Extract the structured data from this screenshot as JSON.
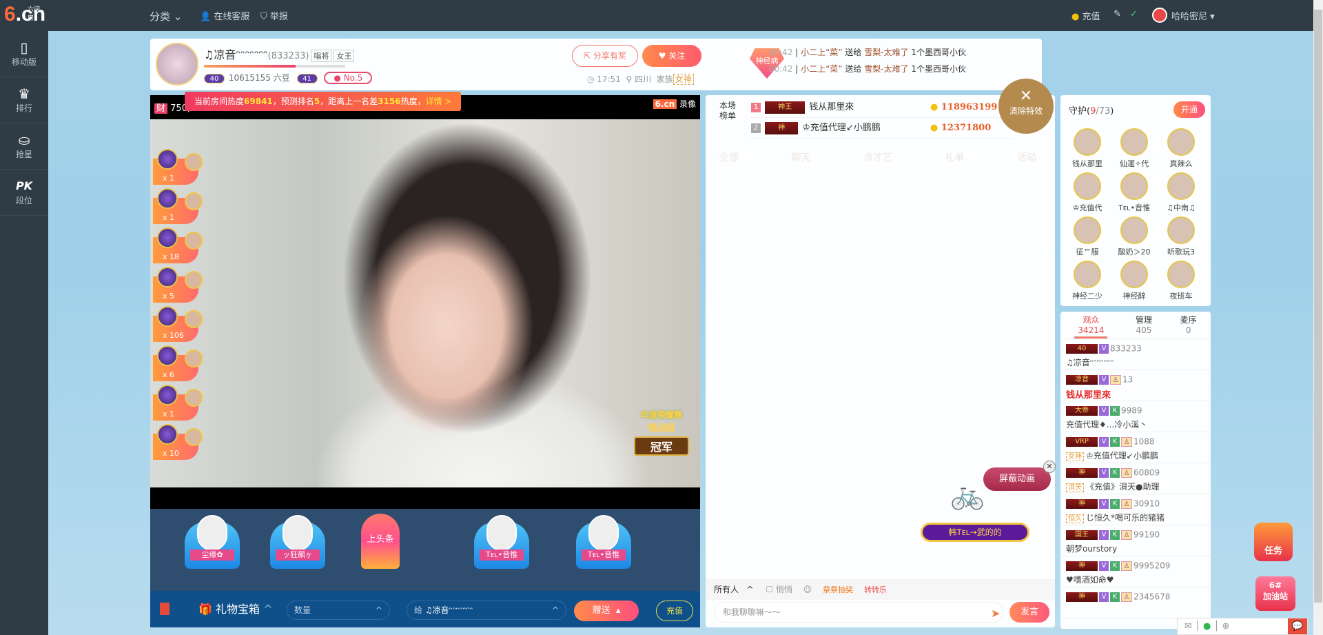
{
  "topbar": {
    "logo_sub": "六间房",
    "logo_main": "6.cn",
    "category": "分类",
    "service": "在线客服",
    "report": "举报",
    "recharge": "充值",
    "username": "哈哈密尼"
  },
  "sidebar": [
    {
      "label": "移动版",
      "icon": "phone-icon"
    },
    {
      "label": "排行",
      "icon": "crown-icon"
    },
    {
      "label": "抢星",
      "icon": "star-bag-icon"
    },
    {
      "label": "段位",
      "icon": "pk-icon",
      "glyph": "PK"
    }
  ],
  "anchor": {
    "name": "♫凉音ᵔᵔᵔᵔᵔᵔᵔ",
    "id": "(833233)",
    "tags": [
      "唱将",
      "女王"
    ],
    "level_left": "40",
    "beans": "10615155 六豆",
    "level_right": "41",
    "rank": "No.5",
    "time": "17:51",
    "location": "四川",
    "family_label": "家族",
    "family": "女神",
    "share": "分享有奖",
    "follow": "关注",
    "badge": "神经病",
    "progress_pct": 65
  },
  "heat_tip": {
    "p1": "当前房间热度",
    "heat": "69841",
    "p2": "，预测排名",
    "rank": "5",
    "p3": "，距离上一名差",
    "diff": "3156",
    "p4": "热度，",
    "link": "详情 >"
  },
  "feed": [
    {
      "time": "00:42",
      "from": "小二上“菜”",
      "action": "送给",
      "to": "雪梨-太难了",
      "gift": "1个墨西哥小伙"
    },
    {
      "time": "00:42",
      "from": "小二上“菜”",
      "action": "送给",
      "to": "雪梨-太难了",
      "gift": "1个墨西哥小伙"
    }
  ],
  "video": {
    "wealth_badge": "财",
    "wealth": "750,",
    "watermark": "6.cn",
    "record": "录像",
    "honor_title": "年度荣耀赛",
    "honor_group": "唱战组",
    "honor_rank": "冠军"
  },
  "gift_list": [
    "x 1",
    "x 1",
    "x 18",
    "x 5",
    "x 106",
    "x 6",
    "x 1",
    "x 10"
  ],
  "seats": [
    "尘缘✿",
    "ッ狂飙ヶ",
    "上头条",
    "Tᴇʟ•音惟",
    "Tᴇʟ•音惟"
  ],
  "bottom": {
    "gift_box": "礼物宝箱",
    "quantity_placeholder": "数量",
    "to_label": "给",
    "to_name": "♫凉音ᵔᵔᵔᵔᵔᵔᵔ",
    "send": "赠送",
    "recharge": "充值"
  },
  "ranking": {
    "label": "本场榜单",
    "rows": [
      {
        "rank": "1",
        "badge": "神王",
        "name": "钱从那里來",
        "score": "118963199"
      },
      {
        "rank": "2",
        "badge": "神",
        "name": "♔充值代理↙小鹏鹏",
        "score": "12371800"
      }
    ]
  },
  "clear_effects": "清除特效",
  "chat": {
    "tabs": [
      "全部",
      "聊天",
      "点才艺",
      "礼单",
      "活动"
    ],
    "block_anim": "屏蔽动画",
    "rider": "韩Tᴇʟ→武的的",
    "target": "所有人",
    "whisper": "悄悄",
    "lottery": "祭祭抽奖",
    "wheel": "转转乐",
    "placeholder": "和我聊聊嘛～～",
    "send": "发言"
  },
  "guard": {
    "title": "守护",
    "count": "9",
    "total": "/73",
    "open": "开通",
    "members": [
      "钱从那里",
      "仙運✧代",
      "真辣么",
      "♔充值代",
      "Tᴇʟ•音惟",
      "♫中南♫",
      "征™服",
      "酸奶＞20",
      "听歌玩3",
      "神经二少",
      "神经醉",
      "夜班车"
    ]
  },
  "audience": {
    "tabs": [
      {
        "label": "观众",
        "count": "34214"
      },
      {
        "label": "管理",
        "count": "405"
      },
      {
        "label": "麦序",
        "count": "0"
      }
    ],
    "rows": [
      {
        "badge": "40",
        "num": "833233",
        "name": "♫凉音ᵔᵔᵔᵔᵔᵔᵔ"
      },
      {
        "badge": "凉音",
        "num": "13",
        "name": "钱从那里來",
        "red": true
      },
      {
        "badge": "大帝",
        "num": "9989",
        "name": "充值代理♦...冷小溪丶"
      },
      {
        "badge": "VRP",
        "num": "1088",
        "name": "♔充值代理↙小鹏鹏",
        "prefix": "女神"
      },
      {
        "badge": "神",
        "num": "60809",
        "name": "《充值》浿天●助理",
        "prefix": "浿天"
      },
      {
        "badge": "神",
        "num": "30910",
        "name": "じ恒久*喝可乐的猪猪",
        "prefix": "恒久"
      },
      {
        "badge": "国王",
        "num": "99190",
        "name": "朝梦ourstory"
      },
      {
        "badge": "神",
        "num": "9995209",
        "name": "♥嗜酒如命♥"
      },
      {
        "badge": "神",
        "num": "2345678",
        "name": ""
      }
    ]
  },
  "float": {
    "task": "任务",
    "station": "加油站",
    "station_no": "6#"
  }
}
